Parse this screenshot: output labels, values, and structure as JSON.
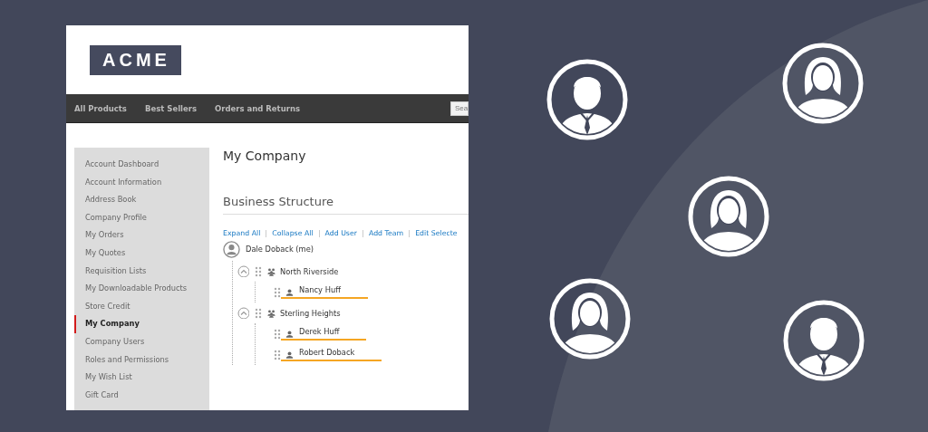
{
  "header": {
    "logo": "ACME"
  },
  "nav": {
    "items": [
      {
        "label": "All Products"
      },
      {
        "label": "Best Sellers"
      },
      {
        "label": "Orders and Returns"
      }
    ],
    "search": {
      "placeholder": "Sea"
    }
  },
  "sidebar": {
    "items": [
      {
        "label": "Account Dashboard",
        "selected": false
      },
      {
        "label": "Account Information",
        "selected": false
      },
      {
        "label": "Address Book",
        "selected": false
      },
      {
        "label": "Company Profile",
        "selected": false
      },
      {
        "label": "My Orders",
        "selected": false
      },
      {
        "label": "My Quotes",
        "selected": false
      },
      {
        "label": "Requisition Lists",
        "selected": false
      },
      {
        "label": "My Downloadable Products",
        "selected": false
      },
      {
        "label": "Store Credit",
        "selected": false
      },
      {
        "label": "My Company",
        "selected": true
      },
      {
        "label": "Company Users",
        "selected": false
      },
      {
        "label": "Roles and Permissions",
        "selected": false
      },
      {
        "label": "My Wish List",
        "selected": false
      },
      {
        "label": "Gift Card",
        "selected": false
      }
    ]
  },
  "page": {
    "title": "My Company",
    "section_title": "Business Structure",
    "actions": [
      "Expand All",
      "Collapse All",
      "Add User",
      "Add Team",
      "Edit Selecte"
    ],
    "tree": {
      "name": "Dale Doback (me)",
      "kind": "admin",
      "children": [
        {
          "name": "North Riverside",
          "kind": "team",
          "expanded": true,
          "children": [
            {
              "name": "Nancy Huff",
              "kind": "user",
              "highlighted": true
            }
          ]
        },
        {
          "name": "Sterling Heights",
          "kind": "team",
          "expanded": true,
          "children": [
            {
              "name": "Derek Huff",
              "kind": "user",
              "highlighted": true
            },
            {
              "name": "Robert Doback",
              "kind": "user",
              "highlighted": true
            }
          ]
        }
      ]
    }
  },
  "avatars": [
    {
      "kind": "male"
    },
    {
      "kind": "female"
    },
    {
      "kind": "female"
    },
    {
      "kind": "female"
    },
    {
      "kind": "male"
    }
  ]
}
